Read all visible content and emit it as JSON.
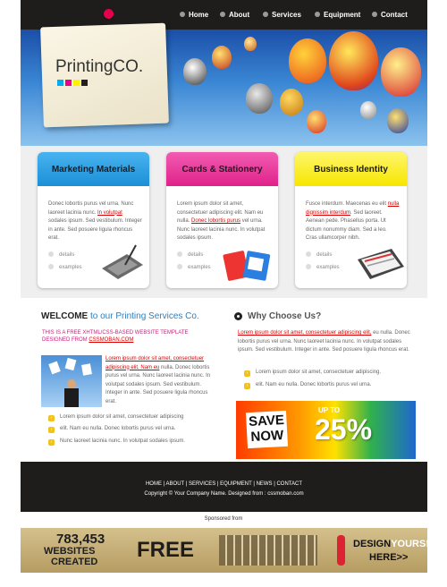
{
  "nav": [
    "Home",
    "About",
    "Services",
    "Equipment",
    "Contact"
  ],
  "logo": "PrintingCO.",
  "boxes": [
    {
      "title": "Marketing Materials",
      "t1": "Donec lobortis purus vel urna. Nunc laoreet lacinia nunc. ",
      "link": "In volutpat",
      "t2": " sodales ipsum. Sed vestibulum. Integer in ante. Sed posuere ligula rhoncus erat.",
      "details": "details",
      "examples": "examples",
      "color": "#1b8fd6"
    },
    {
      "title": "Cards & Stationery",
      "t1": "Lorem ipsum dolor sit amet, consectetuer adipiscing elit. Nam eu nulla. ",
      "link": "Donec lobortis purus",
      "t2": " vel urna. Nunc laoreet lacinia nunc. In volutpat sodales ipsum.",
      "details": "details",
      "examples": "examples",
      "color": "#e0218a"
    },
    {
      "title": "Business Identity",
      "t1": "Fusce interdum. Maecenas eu elit ",
      "link": "nulla dignissim interdum",
      "t2": ". Sed laoreet. Aenean pede. Phasellus porta. Ut dictum nonummy diam. Sed a leo. Cras ullamcorper nibh.",
      "details": "details",
      "examples": "examples",
      "color": "#f6e600"
    }
  ],
  "welcome": {
    "strong": "WELCOME",
    "rest": " to our Printing Services Co."
  },
  "sub": {
    "line": "THIS IS A FREE XHTML/CSS-BASED WEBSITE TEMPLATE DESIGNED FROM ",
    "link": "CSSMOBAN.COM"
  },
  "wpara": {
    "link": "Lorem ipsum dolor sit amet, consectetuer adipiscing elit. Nam eu",
    "rest": " nulla. Donec lobortis purus vel urna. Nunc laoreet lacinia nunc. In volutpat sodales ipsum. Sed vestibulum. Integer in ante. Sed posuere ligula rhoncus erat."
  },
  "wlist": [
    "Lorem ipsum dolor sit amet, consectetuer adipiscing",
    "elit. Nam eu nulla. Donec lobortis purus vel urna.",
    "Nunc laoreet lacinia nunc. In volutpat sodales ipsum."
  ],
  "why": {
    "title": "Why Choose Us?",
    "link": "Lorem ipsum dolor sit amet, consectetuer adipiscing elit,",
    "rest": " eu nulla. Donec lobortis purus vel urna. Nunc laoreet lacinia nunc. In volutpat sodales ipsum. Sed vestibulum. Integer in ante. Sed posuere ligula rhoncus erat."
  },
  "whylist": [
    "Lorem ipsum dolor sit amet, consectetuer adipiscing.",
    "elit. Nam eu nulla. Donec lobortis purus vel urna."
  ],
  "promo": {
    "save": "SAVE",
    "now": "NOW",
    "upto": "UP TO",
    "pct": "25%"
  },
  "footer": {
    "links": "HOME | ABOUT | SERVICES | EQUIPMENT | NEWS | CONTACT",
    "copy": "Copyright © Your Company Name. Designed from : cssmoban.com"
  },
  "sponsor": "Sponsored from",
  "banner": {
    "count": "783,453",
    "websites": "WEBSITES",
    "created": "CREATED",
    "free": "FREE",
    "design": "DESIGN",
    "yours": "YOURS!",
    "here": "HERE>>"
  }
}
